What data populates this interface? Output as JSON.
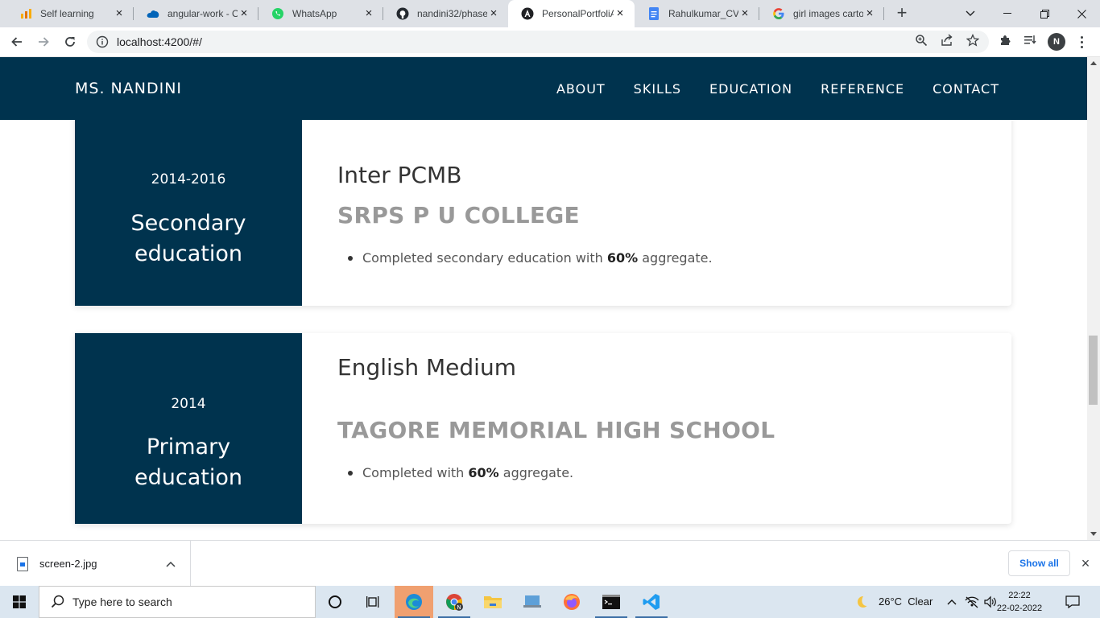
{
  "browser": {
    "tabs": [
      {
        "title": "Self learning",
        "icon": "analytics-icon"
      },
      {
        "title": "angular-work - O",
        "icon": "onedrive-icon"
      },
      {
        "title": "WhatsApp",
        "icon": "whatsapp-icon"
      },
      {
        "title": "nandini32/phase",
        "icon": "github-icon"
      },
      {
        "title": "PersonalPortfoliA",
        "icon": "angular-icon",
        "active": true
      },
      {
        "title": "Rahulkumar_CV.d",
        "icon": "google-docs-icon"
      },
      {
        "title": "girl images carto",
        "icon": "google-icon"
      }
    ],
    "url": "localhost:4200/#/",
    "profile_initial": "N"
  },
  "site": {
    "brand": "MS. NANDINI",
    "nav": [
      "ABOUT",
      "SKILLS",
      "EDUCATION",
      "REFERENCE",
      "CONTACT"
    ],
    "education": [
      {
        "year": "2014-2016",
        "type_line1": "Secondary",
        "type_line2": "education",
        "degree": "Inter PCMB",
        "school": "SRPS P U COLLEGE",
        "point_pre": "Completed secondary education with ",
        "point_bold": "60%",
        "point_post": " aggregate."
      },
      {
        "year": "2014",
        "type_line1": "Primary",
        "type_line2": "education",
        "degree": "English Medium",
        "school": "TAGORE MEMORIAL HIGH SCHOOL",
        "point_pre": "Completed with ",
        "point_bold": "60%",
        "point_post": " aggregate."
      }
    ]
  },
  "downloads": {
    "file": "screen-2.jpg",
    "show_all": "Show all"
  },
  "taskbar": {
    "search_placeholder": "Type here to search",
    "weather": "26°C  Clear",
    "time": "22:22",
    "date": "22-02-2022"
  },
  "colors": {
    "navy": "#00334e",
    "school_gray": "#999999"
  }
}
